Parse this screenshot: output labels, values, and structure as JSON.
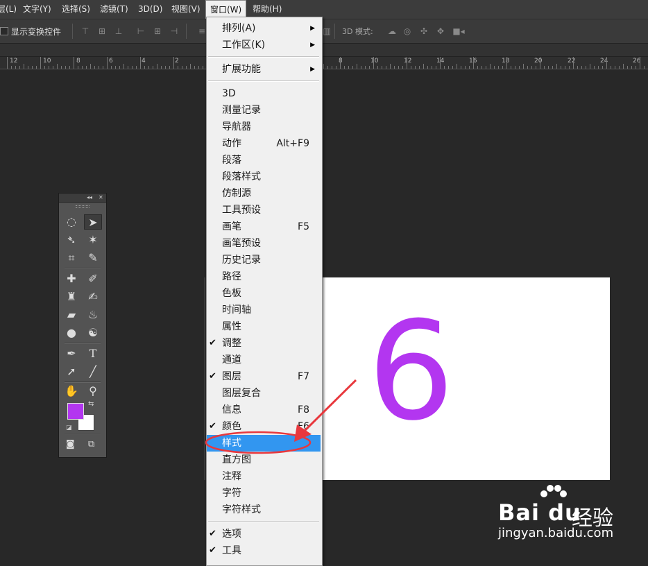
{
  "menubar": {
    "items": [
      {
        "label": "层(L)"
      },
      {
        "label": "文字(Y)"
      },
      {
        "label": "选择(S)"
      },
      {
        "label": "滤镜(T)"
      },
      {
        "label": "3D(D)"
      },
      {
        "label": "视图(V)"
      },
      {
        "label": "窗口(W)"
      },
      {
        "label": "帮助(H)"
      }
    ],
    "active": "窗口(W)"
  },
  "options": {
    "show_transform_label": "显示变换控件",
    "mode_3d_label": "3D 模式:"
  },
  "ruler": {
    "labels": [
      "12",
      "10",
      "8",
      "6",
      "4",
      "2",
      "8",
      "10",
      "12",
      "14",
      "16",
      "18",
      "20",
      "22",
      "24",
      "26"
    ]
  },
  "canvas": {
    "text": "6",
    "text_color": "#b336f0",
    "background": "#ffffff"
  },
  "tools": {
    "foreground_color": "#b336f0",
    "background_color": "#ffffff",
    "text_tool_label": "T"
  },
  "window_menu": {
    "items": [
      {
        "label": "排列(A)",
        "submenu": true
      },
      {
        "label": "工作区(K)",
        "submenu": true
      },
      {
        "label": "扩展功能",
        "submenu": true
      },
      {
        "label": "3D"
      },
      {
        "label": "测量记录"
      },
      {
        "label": "导航器"
      },
      {
        "label": "动作",
        "shortcut": "Alt+F9"
      },
      {
        "label": "段落"
      },
      {
        "label": "段落样式"
      },
      {
        "label": "仿制源"
      },
      {
        "label": "工具预设"
      },
      {
        "label": "画笔",
        "shortcut": "F5"
      },
      {
        "label": "画笔预设"
      },
      {
        "label": "历史记录"
      },
      {
        "label": "路径"
      },
      {
        "label": "色板"
      },
      {
        "label": "时间轴"
      },
      {
        "label": "属性"
      },
      {
        "label": "调整",
        "checked": true
      },
      {
        "label": "通道"
      },
      {
        "label": "图层",
        "shortcut": "F7",
        "checked": true
      },
      {
        "label": "图层复合"
      },
      {
        "label": "信息",
        "shortcut": "F8"
      },
      {
        "label": "颜色",
        "shortcut": "F6",
        "checked": true
      },
      {
        "label": "样式",
        "highlighted": true
      },
      {
        "label": "直方图"
      },
      {
        "label": "注释"
      },
      {
        "label": "字符"
      },
      {
        "label": "字符样式"
      },
      {
        "label": "选项",
        "checked": true
      },
      {
        "label": "工具",
        "checked": true
      }
    ],
    "check_mark": "✔",
    "submenu_arrow": "▶",
    "highlight_color": "#3296f0"
  },
  "annotation": {
    "color": "#e8383d"
  },
  "watermark": {
    "logo": "Bai du",
    "cn": "经验",
    "url": "jingyan.baidu.com"
  }
}
